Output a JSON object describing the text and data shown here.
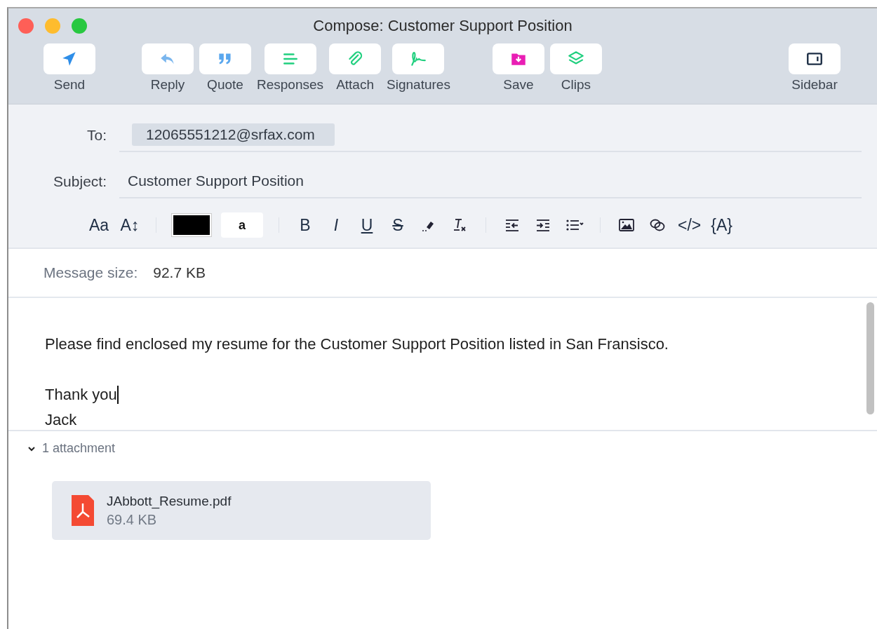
{
  "window": {
    "title": "Compose: Customer Support Position"
  },
  "toolbar": {
    "groups": [
      {
        "items": [
          {
            "label": "Send",
            "kind": "send"
          }
        ]
      },
      {
        "items": [
          {
            "label": "Reply",
            "kind": "reply"
          },
          {
            "label": "Quote",
            "kind": "quote"
          },
          {
            "label": "Responses",
            "kind": "responses"
          },
          {
            "label": "Attach",
            "kind": "attach"
          },
          {
            "label": "Signatures",
            "kind": "signature"
          }
        ]
      },
      {
        "items": [
          {
            "label": "Save",
            "kind": "save"
          },
          {
            "label": "Clips",
            "kind": "layers"
          }
        ]
      },
      {
        "items": [
          {
            "label": "Sidebar",
            "kind": "sidebar"
          }
        ]
      }
    ]
  },
  "header": {
    "to": {
      "label": "To:",
      "recipients": [
        "12065551212@srfax.com"
      ]
    },
    "subject": {
      "label": "Subject:",
      "value": "Customer Support Position"
    }
  },
  "format_bar": {
    "groups": [
      {
        "items": [
          {
            "kind": "glyph",
            "text": "Aa"
          },
          {
            "kind": "glyph",
            "text": "A↕"
          }
        ]
      },
      {
        "items": [
          {
            "kind": "swatch",
            "color": "#000000"
          },
          {
            "kind": "highlight",
            "text": "a"
          }
        ]
      },
      {
        "items": [
          {
            "kind": "glyph",
            "text": "B"
          },
          {
            "kind": "glyph",
            "text": "I"
          },
          {
            "kind": "glyph",
            "text": "U"
          },
          {
            "kind": "glyph",
            "text": "S"
          },
          {
            "kind": "highlighter"
          },
          {
            "kind": "clear-format"
          }
        ]
      },
      {
        "items": [
          {
            "kind": "outdent"
          },
          {
            "kind": "indent"
          },
          {
            "kind": "list"
          }
        ]
      },
      {
        "items": [
          {
            "kind": "image"
          },
          {
            "kind": "link"
          },
          {
            "kind": "glyph",
            "text": "</>"
          },
          {
            "kind": "glyph",
            "text": "{A}"
          }
        ]
      }
    ]
  },
  "message_size": {
    "label": "Message size:",
    "value": "92.7 KB"
  },
  "body": {
    "paragraphs": [
      {
        "lines": [
          {
            "text": "Please find enclosed my resume for the Customer Support Position listed in San Fransisco.",
            "cursor": false
          }
        ]
      },
      {
        "lines": [
          {
            "text": "Thank you",
            "cursor": true
          },
          {
            "text": "Jack",
            "cursor": false
          }
        ]
      }
    ]
  },
  "attachments": {
    "label": "1 attachment",
    "expanded": true,
    "files": [
      {
        "name": "JAbbott_Resume.pdf",
        "size": "69.4 KB"
      }
    ]
  }
}
